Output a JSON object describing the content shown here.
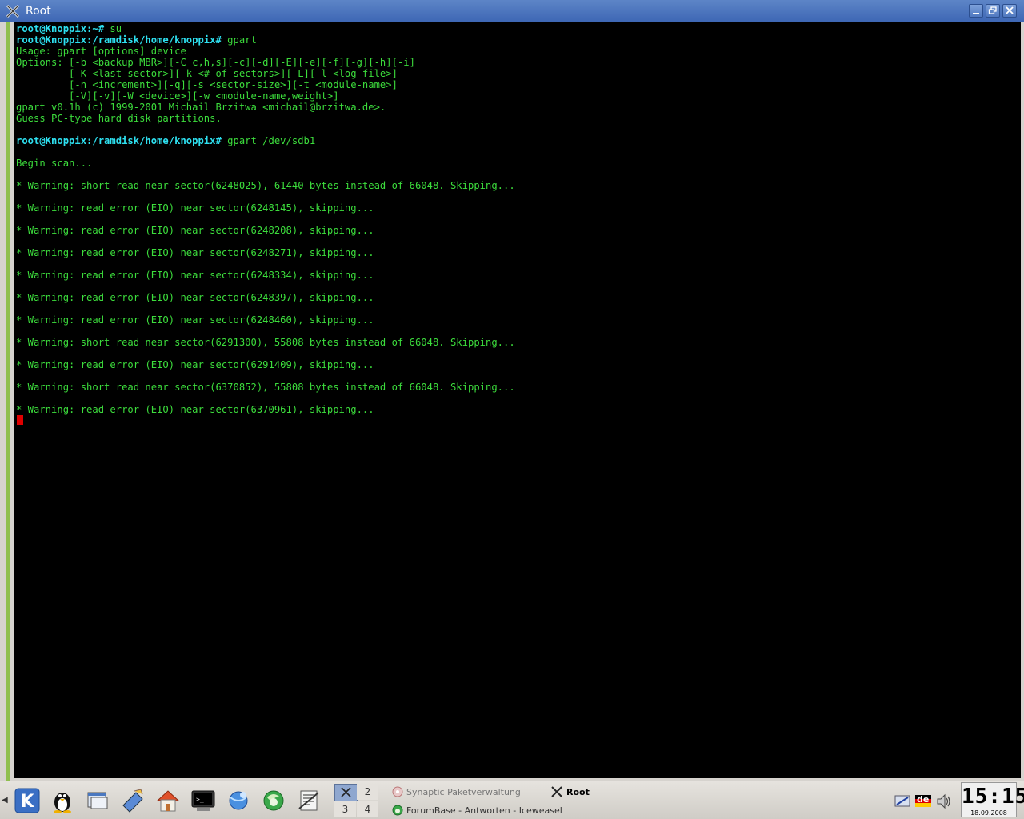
{
  "window": {
    "title": "Root"
  },
  "terminal": {
    "prompt_home": "root@Knoppix:~#",
    "prompt_ramdisk": "root@Knoppix:/ramdisk/home/knoppix#",
    "lines": [
      {
        "type": "cmd",
        "prompt": "root@Knoppix:~#",
        "text": " su"
      },
      {
        "type": "cmd",
        "prompt": "root@Knoppix:/ramdisk/home/knoppix#",
        "text": " gpart"
      },
      {
        "type": "out",
        "text": "Usage: gpart [options] device"
      },
      {
        "type": "out",
        "text": "Options: [-b <backup MBR>][-C c,h,s][-c][-d][-E][-e][-f][-g][-h][-i]"
      },
      {
        "type": "out",
        "text": "         [-K <last sector>][-k <# of sectors>][-L][-l <log file>]"
      },
      {
        "type": "out",
        "text": "         [-n <increment>][-q][-s <sector-size>][-t <module-name>]"
      },
      {
        "type": "out",
        "text": "         [-V][-v][-W <device>][-w <module-name,weight>]"
      },
      {
        "type": "out",
        "text": "gpart v0.1h (c) 1999-2001 Michail Brzitwa <michail@brzitwa.de>."
      },
      {
        "type": "out",
        "text": "Guess PC-type hard disk partitions."
      },
      {
        "type": "out",
        "text": ""
      },
      {
        "type": "cmd",
        "prompt": "root@Knoppix:/ramdisk/home/knoppix#",
        "text": " gpart /dev/sdb1"
      },
      {
        "type": "out",
        "text": ""
      },
      {
        "type": "out",
        "text": "Begin scan..."
      },
      {
        "type": "out",
        "text": ""
      },
      {
        "type": "out",
        "text": "* Warning: short read near sector(6248025), 61440 bytes instead of 66048. Skipping..."
      },
      {
        "type": "out",
        "text": ""
      },
      {
        "type": "out",
        "text": "* Warning: read error (EIO) near sector(6248145), skipping..."
      },
      {
        "type": "out",
        "text": ""
      },
      {
        "type": "out",
        "text": "* Warning: read error (EIO) near sector(6248208), skipping..."
      },
      {
        "type": "out",
        "text": ""
      },
      {
        "type": "out",
        "text": "* Warning: read error (EIO) near sector(6248271), skipping..."
      },
      {
        "type": "out",
        "text": ""
      },
      {
        "type": "out",
        "text": "* Warning: read error (EIO) near sector(6248334), skipping..."
      },
      {
        "type": "out",
        "text": ""
      },
      {
        "type": "out",
        "text": "* Warning: read error (EIO) near sector(6248397), skipping..."
      },
      {
        "type": "out",
        "text": ""
      },
      {
        "type": "out",
        "text": "* Warning: read error (EIO) near sector(6248460), skipping..."
      },
      {
        "type": "out",
        "text": ""
      },
      {
        "type": "out",
        "text": "* Warning: short read near sector(6291300), 55808 bytes instead of 66048. Skipping..."
      },
      {
        "type": "out",
        "text": ""
      },
      {
        "type": "out",
        "text": "* Warning: read error (EIO) near sector(6291409), skipping..."
      },
      {
        "type": "out",
        "text": ""
      },
      {
        "type": "out",
        "text": "* Warning: short read near sector(6370852), 55808 bytes instead of 66048. Skipping..."
      },
      {
        "type": "out",
        "text": ""
      },
      {
        "type": "out",
        "text": "* Warning: read error (EIO) near sector(6370961), skipping..."
      }
    ],
    "colors": {
      "output": "#3cdc3c",
      "prompt": "#2ee0f0",
      "cursor": "#e00000",
      "background": "#000000"
    }
  },
  "taskbar": {
    "launchers": [
      {
        "icon": "kde-menu-icon"
      },
      {
        "icon": "tux-icon"
      },
      {
        "icon": "window-list-icon"
      },
      {
        "icon": "knoppix-config-icon"
      },
      {
        "icon": "home-folder-icon"
      },
      {
        "icon": "terminal-icon"
      },
      {
        "icon": "konqueror-icon"
      },
      {
        "icon": "iceweasel-icon"
      },
      {
        "icon": "office-icon"
      }
    ],
    "pager": [
      "1",
      "2",
      "3",
      "4"
    ],
    "tasks": [
      {
        "label": "Synaptic Paketverwaltung",
        "icon": "synaptic-icon"
      },
      {
        "label": "ForumBase - Antworten - Iceweasel",
        "icon": "iceweasel-task-icon"
      },
      {
        "label": "Root",
        "icon": "x-terminal-icon"
      }
    ],
    "tray": [
      {
        "icon": "network-icon"
      },
      {
        "icon": "keyboard-layout-icon",
        "label": "de"
      },
      {
        "icon": "volume-icon"
      }
    ],
    "clock": {
      "time": "15:15",
      "date": "18.09.2008"
    }
  }
}
